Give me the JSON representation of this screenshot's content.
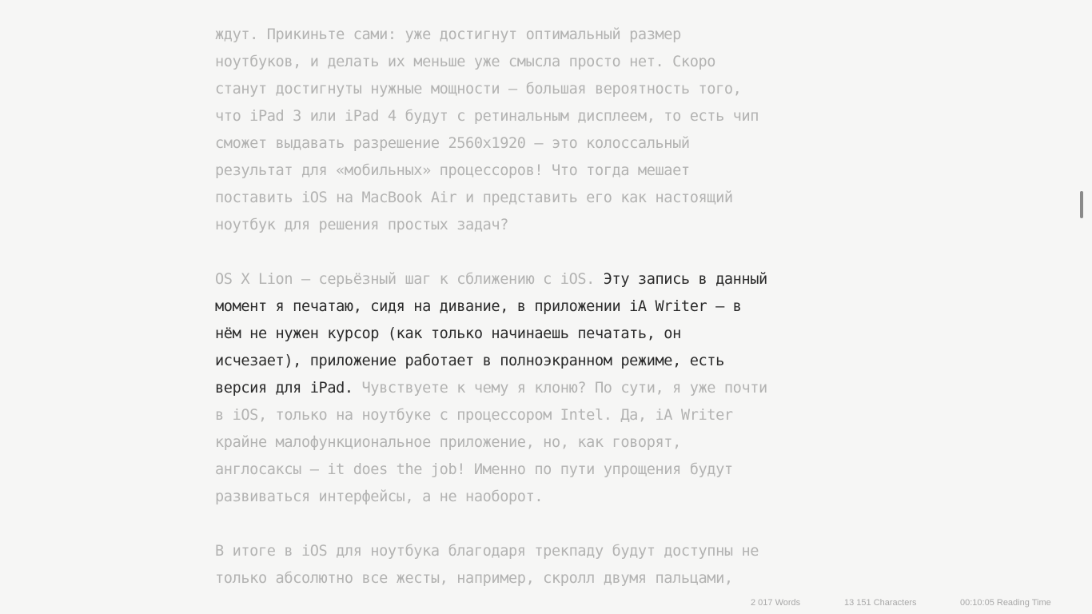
{
  "document": {
    "paragraphs": [
      {
        "lines": [
          [
            {
              "text": "ждут. Прикиньте сами: уже достигнут оптимальный размер",
              "focus": false
            }
          ],
          [
            {
              "text": "ноутбуков, и делать их меньше уже смысла просто нет. Скоро",
              "focus": false
            }
          ],
          [
            {
              "text": "станут достигнуты нужные мощности — большая вероятность того,",
              "focus": false
            }
          ],
          [
            {
              "text": "что iPad 3 или iPad 4 будут с ретинальным дисплеем, то есть чип",
              "focus": false
            }
          ],
          [
            {
              "text": "сможет выдавать разрешение 2560x1920 — это колоссальный",
              "focus": false
            }
          ],
          [
            {
              "text": "результат для «мобильных» процессоров! Что тогда мешает",
              "focus": false
            }
          ],
          [
            {
              "text": "поставить iOS на MacBook Air и представить его как настоящий",
              "focus": false
            }
          ],
          [
            {
              "text": "ноутбук для решения простых задач?",
              "focus": false
            }
          ]
        ]
      },
      {
        "lines": [
          [
            {
              "text": "OS X Lion — серьёзный шаг к сближению с iOS. ",
              "focus": false
            },
            {
              "text": "Эту запись в данный",
              "focus": true
            }
          ],
          [
            {
              "text": "момент я печатаю, сидя на дивание, в приложении iA Writer — в",
              "focus": true
            }
          ],
          [
            {
              "text": "нём не нужен курсор (как только начинаешь печатать, он",
              "focus": true
            }
          ],
          [
            {
              "text": "исчезает), приложение работает в полноэкранном режиме, есть",
              "focus": true
            }
          ],
          [
            {
              "text": "версия для iPad.",
              "focus": true
            },
            {
              "text": " Чувствуете к чему я клоню? По сути, я уже почти",
              "focus": false
            }
          ],
          [
            {
              "text": "в iOS, только на ноутбуке с процессором Intel. Да, iA Writer",
              "focus": false
            }
          ],
          [
            {
              "text": "крайне малофункциональное приложение, но, как говорят,",
              "focus": false
            }
          ],
          [
            {
              "text": "англосаксы — it does the job! Именно по пути упрощения будут",
              "focus": false
            }
          ],
          [
            {
              "text": "развиваться интерфейсы, а не наоборот.",
              "focus": false
            }
          ]
        ]
      },
      {
        "lines": [
          [
            {
              "text": "В итоге в iOS для ноутбука благодаря трекпаду будут доступны не",
              "focus": false
            }
          ],
          [
            {
              "text": "только абсолютно все жесты, например, скролл двумя пальцами,",
              "focus": false
            }
          ]
        ]
      }
    ]
  },
  "status": {
    "words": "2 017 Words",
    "characters": "13 151 Characters",
    "reading_time": "00:10:05 Reading Time"
  },
  "colors": {
    "background": "#f6f6f5",
    "text_dimmed": "#b3b3b2",
    "text_focus": "#2b2b2b",
    "status_text": "#a8a8a8",
    "scrollbar": "#8a8a8a"
  }
}
